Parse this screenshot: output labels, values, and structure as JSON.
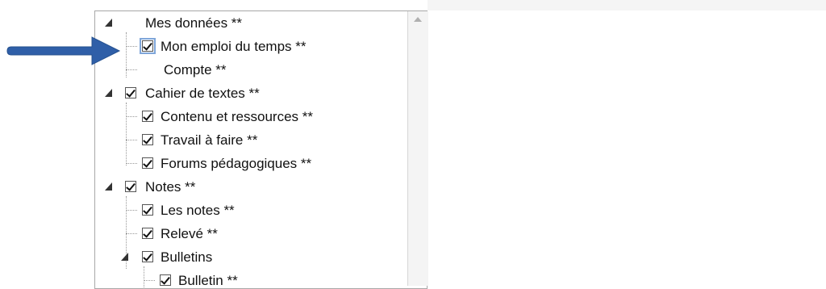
{
  "tree": {
    "items": [
      {
        "label": "Mes données **",
        "checked": false
      },
      {
        "label": "Mon emploi du temps **",
        "checked": true
      },
      {
        "label": "Compte **",
        "checked": false
      },
      {
        "label": "Cahier de textes **",
        "checked": true
      },
      {
        "label": "Contenu et ressources **",
        "checked": true
      },
      {
        "label": "Travail à faire **",
        "checked": true
      },
      {
        "label": "Forums pédagogiques **",
        "checked": true
      },
      {
        "label": "Notes **",
        "checked": true
      },
      {
        "label": "Les notes **",
        "checked": true
      },
      {
        "label": "Relevé **",
        "checked": true
      },
      {
        "label": "Bulletins",
        "checked": true
      },
      {
        "label": "Bulletin **",
        "checked": true
      }
    ]
  },
  "colors": {
    "arrow": "#2f5fa8",
    "checkbox_highlight": "#7fa6d9"
  },
  "icons": {
    "pointer": "arrow-right-icon",
    "expand": "expander-triangle-icon",
    "scroll": "scroll-up-arrow-icon"
  }
}
